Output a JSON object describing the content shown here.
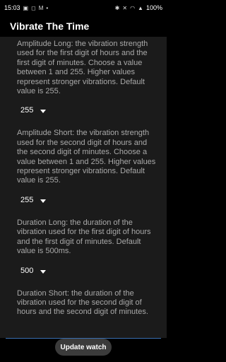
{
  "status_bar": {
    "time": "15:03",
    "left_icons": [
      "image-icon",
      "message-icon",
      "gmail-icon",
      "dot"
    ],
    "right_icons": [
      "bluetooth-icon",
      "mute-icon",
      "wifi-icon",
      "signal-icon"
    ],
    "battery": "100%"
  },
  "app_bar": {
    "title": "Vibrate The Time"
  },
  "settings": [
    {
      "description": "Amplitude Long: the vibration strength used for the first digit of hours and the first digit of minutes. Choose a value between 1 and 255. Higher values represent stronger vibrations. Default value is 255.",
      "value": "255"
    },
    {
      "description": "Amplitude Short: the vibration strength used for the second digit of hours and the second digit of minutes. Choose a value between 1 and 255. Higher values represent stronger vibrations. Default value is 255.",
      "value": "255"
    },
    {
      "description": "Duration Long: the duration of the vibration used for the first digit of hours and the first digit of minutes. Default value is 500ms.",
      "value": "500"
    },
    {
      "description": "Duration Short: the duration of the vibration used for the second digit of hours and the second digit of minutes."
    }
  ],
  "update_button": {
    "label": "Update watch"
  },
  "colors": {
    "background": "#000000",
    "content": "#1b1b1b",
    "text_muted": "#a9a9a9",
    "button": "#3b3b3b"
  }
}
